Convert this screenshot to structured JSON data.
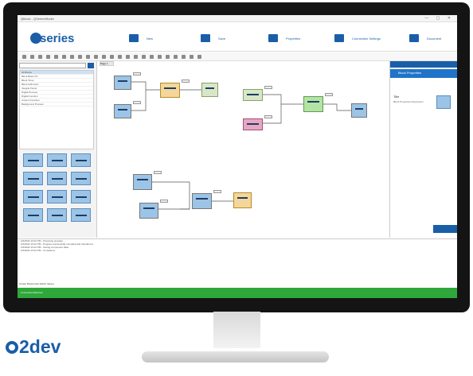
{
  "app": {
    "window_title": "Qblock - QSeriesStudio",
    "logo": "series",
    "menu": [
      {
        "label": "New",
        "icon": "folder-icon"
      },
      {
        "label": "Save",
        "icon": "save-icon"
      },
      {
        "label": "Properties",
        "icon": "truck-icon"
      },
      {
        "label": "Connection Settings",
        "icon": "connection-icon"
      },
      {
        "label": "Document",
        "icon": "document-icon"
      }
    ]
  },
  "sidebar": {
    "categories": [
      "All Blocks",
      "Block Basic I/O",
      "Block Timer",
      "Block Arithmetic",
      "Integral Points",
      "Digital Process",
      "Digital Function",
      "Custom Function",
      "Background Process"
    ]
  },
  "canvas": {
    "tab_label": "Page 1"
  },
  "properties": {
    "header": "Block Properties",
    "label": "Title",
    "description": "Block Properties Description"
  },
  "log": {
    "lines": [
      "2/4/2022 10:22 PM - Preparing program...",
      "2/4/2022 10:22 PM - Program successfully compiled and transferred",
      "2/4/2022 10:22 PM - Saving component data...",
      "2/4/2022 10:22 PM - Completed."
    ],
    "tabs": "Output   Bookmarks   Watch Values"
  },
  "statusbar": {
    "text": "Connected   QSeries1"
  },
  "brand": "2dev",
  "colors": {
    "brand": "#1a5ea8",
    "status": "#2ea83a"
  }
}
